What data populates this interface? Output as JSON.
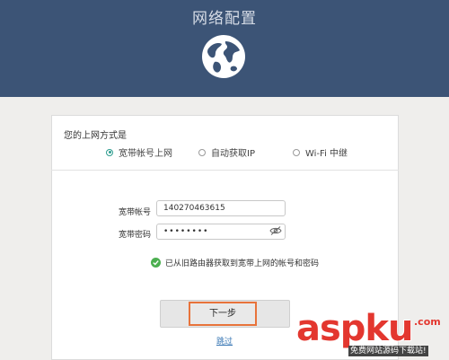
{
  "header": {
    "title": "网络配置"
  },
  "form": {
    "method_title": "您的上网方式是",
    "options": [
      {
        "label": "宽带帐号上网",
        "checked": true
      },
      {
        "label": "自动获取IP",
        "checked": false
      },
      {
        "label": "Wi-Fi 中继",
        "checked": false
      }
    ],
    "account": {
      "label": "宽带帐号",
      "value": "140270463615"
    },
    "password": {
      "label": "宽带密码",
      "value": "••••••••"
    },
    "status_text": "已从旧路由器获取到宽带上网的帐号和密码",
    "next_label": "下一步",
    "skip_label": "跳过"
  },
  "watermark": {
    "main": "aspku",
    "suffix": ".com",
    "sub": "免费网站源码下载站!"
  },
  "colors": {
    "header": "#3c5476",
    "accent": "#2e9d8f",
    "highlight": "#e8733b",
    "check": "#4caf50"
  }
}
